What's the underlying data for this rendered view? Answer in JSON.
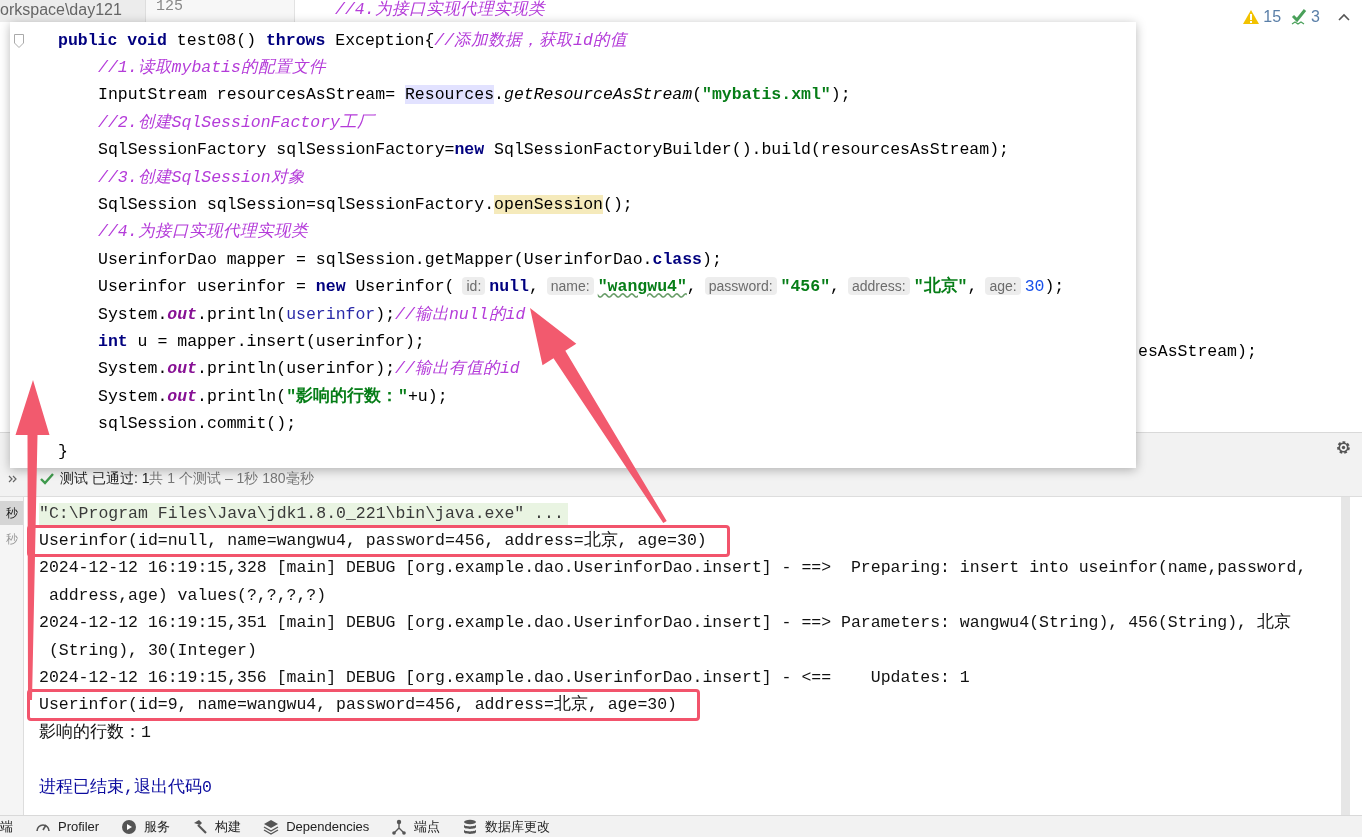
{
  "editor": {
    "path": "orkspace\\day121",
    "line_number": "125",
    "top_line": "//4.为接口实现代理实现类",
    "side_text": "esAsStream);",
    "warnings": "15",
    "weak_warnings": "3"
  },
  "popup": {
    "lines": [
      {
        "kind": "head",
        "tokens": [
          {
            "kind": "kw",
            "text": "public void "
          },
          {
            "kind": "plain",
            "text": "test08() "
          },
          {
            "kind": "kw",
            "text": "throws "
          },
          {
            "kind": "plain",
            "text": "Exception{"
          },
          {
            "kind": "comment",
            "text": "//添加数据，获取id的值"
          }
        ]
      },
      {
        "kind": "body",
        "tokens": [
          {
            "kind": "comment",
            "text": "//1.读取mybatis的配置文件"
          }
        ]
      },
      {
        "kind": "body",
        "tokens": [
          {
            "kind": "plain",
            "text": "InputStream resourcesAsStream= "
          },
          {
            "kind": "ref",
            "text": "Resources"
          },
          {
            "kind": "plain",
            "text": "."
          },
          {
            "kind": "call",
            "text": "getResourceAsStream"
          },
          {
            "kind": "plain",
            "text": "("
          },
          {
            "kind": "str",
            "text": "\"mybatis.xml\""
          },
          {
            "kind": "plain",
            "text": ");"
          }
        ]
      },
      {
        "kind": "body",
        "tokens": [
          {
            "kind": "comment",
            "text": "//2.创建SqlSessionFactory工厂"
          }
        ]
      },
      {
        "kind": "body",
        "tokens": [
          {
            "kind": "plain",
            "text": "SqlSessionFactory sqlSessionFactory="
          },
          {
            "kind": "kw",
            "text": "new"
          },
          {
            "kind": "plain",
            "text": " SqlSessionFactoryBuilder().build(resourcesAsStream);"
          }
        ]
      },
      {
        "kind": "body",
        "tokens": [
          {
            "kind": "comment",
            "text": "//3.创建SqlSession对象"
          }
        ]
      },
      {
        "kind": "body",
        "tokens": [
          {
            "kind": "plain",
            "text": "SqlSession sqlSession=sqlSessionFactory."
          },
          {
            "kind": "usage",
            "text": "openSession"
          },
          {
            "kind": "plain",
            "text": "();"
          }
        ]
      },
      {
        "kind": "body",
        "tokens": [
          {
            "kind": "comment",
            "text": "//4.为接口实现代理实现类"
          }
        ]
      },
      {
        "kind": "body",
        "tokens": [
          {
            "kind": "plain",
            "text": "UserinforDao mapper = sqlSession.getMapper(UserinforDao."
          },
          {
            "kind": "kw",
            "text": "class"
          },
          {
            "kind": "plain",
            "text": ");"
          }
        ]
      },
      {
        "kind": "body",
        "tokens": [
          {
            "kind": "plain",
            "text": "Userinfor userinfor = "
          },
          {
            "kind": "kw",
            "text": "new"
          },
          {
            "kind": "plain",
            "text": " Userinfor("
          },
          {
            "kind": "hint",
            "text": "id:"
          },
          {
            "kind": "kw",
            "text": "null"
          },
          {
            "kind": "plain",
            "text": ","
          },
          {
            "kind": "hint",
            "text": "name:"
          },
          {
            "kind": "typo",
            "text": "\"wangwu4\""
          },
          {
            "kind": "plain",
            "text": ","
          },
          {
            "kind": "hint",
            "text": "password:"
          },
          {
            "kind": "str",
            "text": "\"456\""
          },
          {
            "kind": "plain",
            "text": ","
          },
          {
            "kind": "hint",
            "text": "address:"
          },
          {
            "kind": "str",
            "text": "\"北京\""
          },
          {
            "kind": "plain",
            "text": ","
          },
          {
            "kind": "hint",
            "text": "age:"
          },
          {
            "kind": "num",
            "text": "30"
          },
          {
            "kind": "plain",
            "text": ");"
          }
        ]
      },
      {
        "kind": "body",
        "tokens": [
          {
            "kind": "plain",
            "text": "System."
          },
          {
            "kind": "field",
            "text": "out"
          },
          {
            "kind": "plain",
            "text": ".println("
          },
          {
            "kind": "var",
            "text": "userinfor"
          },
          {
            "kind": "plain",
            "text": ");"
          },
          {
            "kind": "comment",
            "text": "//输出null的id"
          }
        ]
      },
      {
        "kind": "body",
        "tokens": [
          {
            "kind": "kw",
            "text": "int"
          },
          {
            "kind": "plain",
            "text": " u = mapper.insert(userinfor);"
          }
        ]
      },
      {
        "kind": "body",
        "tokens": [
          {
            "kind": "plain",
            "text": "System."
          },
          {
            "kind": "field",
            "text": "out"
          },
          {
            "kind": "plain",
            "text": ".println(userinfor);"
          },
          {
            "kind": "comment",
            "text": "//输出有值的id"
          }
        ]
      },
      {
        "kind": "body",
        "tokens": [
          {
            "kind": "plain",
            "text": "System."
          },
          {
            "kind": "field",
            "text": "out"
          },
          {
            "kind": "plain",
            "text": ".println("
          },
          {
            "kind": "str",
            "text": "\"影响的行数：\""
          },
          {
            "kind": "plain",
            "text": "+u);"
          }
        ]
      },
      {
        "kind": "body",
        "tokens": [
          {
            "kind": "plain",
            "text": "sqlSession.commit();"
          }
        ]
      },
      {
        "kind": "close",
        "tokens": [
          {
            "kind": "plain",
            "text": "}"
          }
        ]
      }
    ]
  },
  "test_bar": {
    "passed": true,
    "status": "测试 已通过: 1",
    "detail": "共 1 个测试 – 1秒 180毫秒"
  },
  "test_tree": [
    {
      "label": "秒",
      "selected": true
    },
    {
      "label": "秒",
      "selected": false
    }
  ],
  "console": [
    {
      "kind": "cmd",
      "text": "\"C:\\Program Files\\Java\\jdk1.8.0_221\\bin\\java.exe\" ...",
      "boxed": false
    },
    {
      "kind": "out",
      "text": "Userinfor(id=null, name=wangwu4, password=456, address=北京, age=30)",
      "boxed": true
    },
    {
      "kind": "out",
      "text": "2024-12-12 16:19:15,328 [main] DEBUG [org.example.dao.UserinforDao.insert] - ==>  Preparing: insert into useinfor(name,password,",
      "boxed": false
    },
    {
      "kind": "out",
      "text": " address,age) values(?,?,?,?)",
      "boxed": false
    },
    {
      "kind": "out",
      "text": "2024-12-12 16:19:15,351 [main] DEBUG [org.example.dao.UserinforDao.insert] - ==> Parameters: wangwu4(String), 456(String), 北京",
      "boxed": false
    },
    {
      "kind": "out",
      "text": " (String), 30(Integer)",
      "boxed": false
    },
    {
      "kind": "out",
      "text": "2024-12-12 16:19:15,356 [main] DEBUG [org.example.dao.UserinforDao.insert] - <==    Updates: 1",
      "boxed": false
    },
    {
      "kind": "out",
      "text": "Userinfor(id=9, name=wangwu4, password=456, address=北京, age=30)",
      "boxed": true
    },
    {
      "kind": "out",
      "text": "影响的行数：1",
      "boxed": false
    },
    {
      "kind": "exit",
      "text": "进程已结束,退出代码0",
      "boxed": false
    }
  ],
  "tool_windows": [
    {
      "kind": "text",
      "label": "端"
    },
    {
      "kind": "gauge",
      "label": "Profiler"
    },
    {
      "kind": "play",
      "label": "服务"
    },
    {
      "kind": "hammer",
      "label": "构建"
    },
    {
      "kind": "layers",
      "label": "Dependencies"
    },
    {
      "kind": "nodes",
      "label": "端点"
    },
    {
      "kind": "database",
      "label": "数据库更改"
    }
  ]
}
